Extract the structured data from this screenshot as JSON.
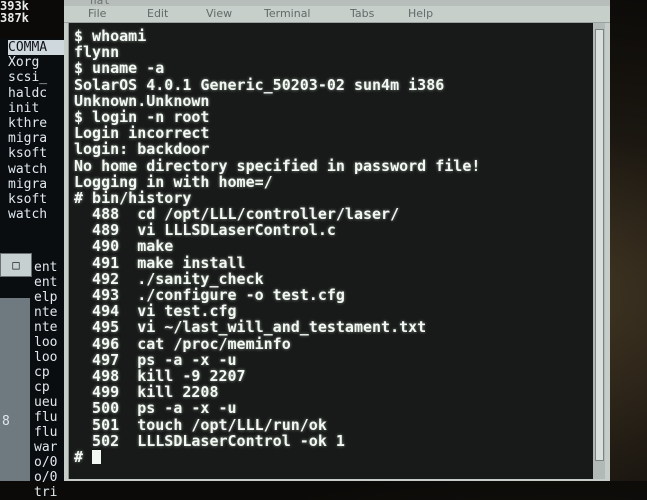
{
  "topleft": {
    "lines": [
      "393k",
      "387k"
    ]
  },
  "left_window": {
    "items": [
      "COMMA",
      "Xorg",
      "scsi_",
      "haldc",
      "init",
      "kthre",
      "migra",
      "ksoft",
      "watch",
      "migra",
      "ksoft",
      "watch"
    ],
    "selected_index": 0,
    "scroll_glyph": "□",
    "items2": [
      "ent",
      "ent",
      "elp",
      "nte",
      "nte",
      "loo",
      "loo",
      "cp",
      "cp",
      "ueu",
      "flu",
      "flu",
      "war",
      "o/0",
      "o/0",
      "tri"
    ],
    "bottom_digit": "8"
  },
  "terminal": {
    "title_fragment": "nal",
    "menu": [
      "File",
      "Edit",
      "View",
      "Terminal",
      "Tabs",
      "Help"
    ],
    "lines": [
      "$ whoami",
      "flynn",
      "$ uname -a",
      "SolarOS 4.0.1 Generic_50203-02 sun4m i386",
      "Unknown.Unknown",
      "$ login -n root",
      "Login incorrect",
      "login: backdoor",
      "No home directory specified in password file!",
      "Logging in with home=/",
      "# bin/history",
      "  488  cd /opt/LLL/controller/laser/",
      "  489  vi LLLSDLaserControl.c",
      "  490  make",
      "  491  make install",
      "  492  ./sanity_check",
      "  493  ./configure -o test.cfg",
      "  494  vi test.cfg",
      "  495  vi ~/last_will_and_testament.txt",
      "  496  cat /proc/meminfo",
      "  497  ps -a -x -u",
      "  498  kill -9 2207",
      "  499  kill 2208",
      "  500  ps -a -x -u",
      "  501  touch /opt/LLL/run/ok",
      "  502  LLLSDLaserControl -ok 1"
    ],
    "prompt": "# "
  }
}
